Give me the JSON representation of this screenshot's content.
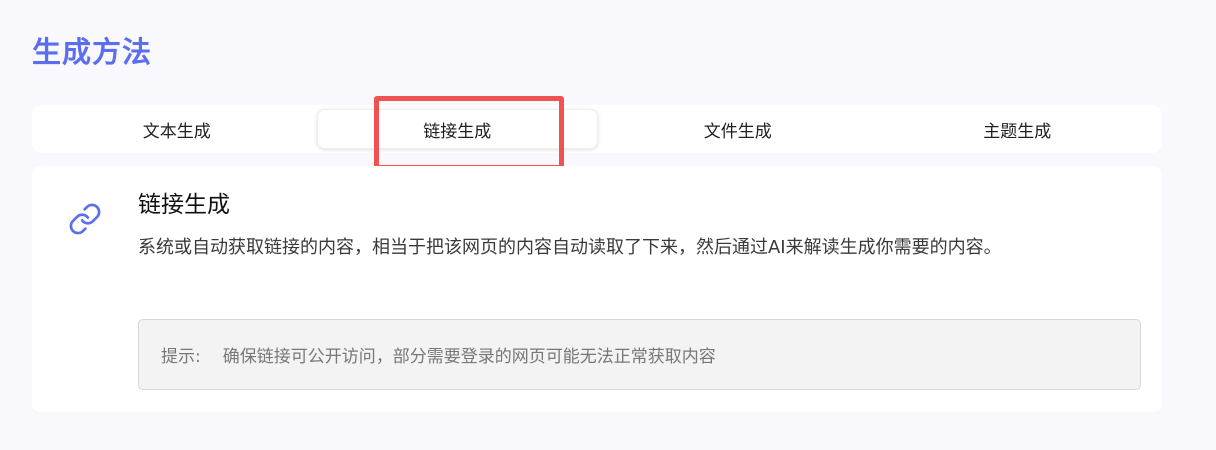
{
  "section": {
    "title": "生成方法"
  },
  "tabs": [
    {
      "label": "文本生成",
      "active": false
    },
    {
      "label": "链接生成",
      "active": true
    },
    {
      "label": "文件生成",
      "active": false
    },
    {
      "label": "主题生成",
      "active": false
    }
  ],
  "colors": {
    "accent": "#5b6ef0",
    "highlight": "#f05252"
  },
  "card": {
    "icon": "link-icon",
    "title": "链接生成",
    "description": "系统或自动获取链接的内容，相当于把该网页的内容自动读取了下来，然后通过AI来解读生成你需要的内容。",
    "tip": {
      "label": "提示:",
      "text": "确保链接可公开访问，部分需要登录的网页可能无法正常获取内容"
    }
  }
}
